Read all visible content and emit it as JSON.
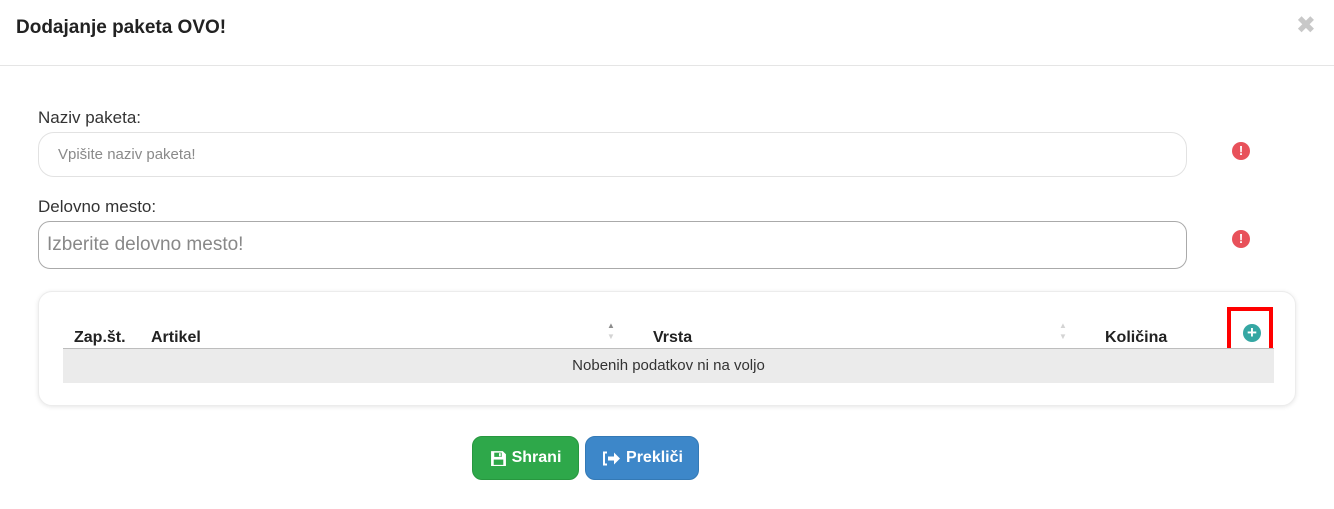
{
  "dialog": {
    "title": "Dodajanje paketa OVO!",
    "close_glyph": "✖"
  },
  "form": {
    "package_name": {
      "label": "Naziv paketa:",
      "placeholder": "Vpišite naziv paketa!",
      "value": "",
      "warning_icon": "exclamation-circle-icon"
    },
    "workplace": {
      "label": "Delovno mesto:",
      "placeholder": "Izberite delovno mesto!",
      "value": "",
      "warning_icon": "exclamation-circle-icon"
    }
  },
  "table": {
    "columns": [
      "Zap.št.",
      "Artikel",
      "Vrsta",
      "Količina"
    ],
    "empty_message": "Nobenih podatkov ni na voljo",
    "rows": [],
    "add_icon": "plus-circle-icon"
  },
  "buttons": {
    "save": {
      "label": "Shrani",
      "icon": "floppy-disk-icon"
    },
    "cancel": {
      "label": "Prekliči",
      "icon": "sign-out-icon"
    }
  },
  "colors": {
    "save": "#2ea84a",
    "cancel": "#3d87c9",
    "warning": "#e8515a",
    "add": "#35a7a3",
    "highlight": "#ff0000"
  }
}
